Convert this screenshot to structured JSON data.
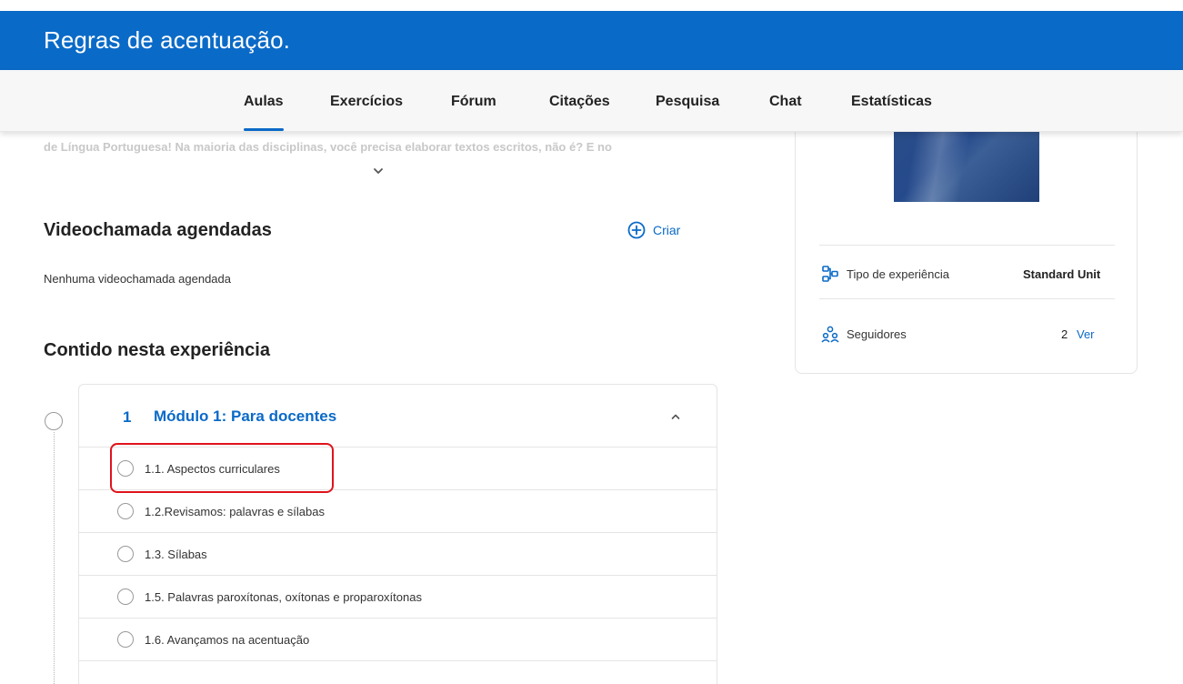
{
  "header": {
    "title": "Regras de acentuação."
  },
  "tabs": [
    {
      "label": "Aulas",
      "active": true
    },
    {
      "label": "Exercícios"
    },
    {
      "label": "Fórum"
    },
    {
      "label": "Citações"
    },
    {
      "label": "Pesquisa"
    },
    {
      "label": "Chat"
    },
    {
      "label": "Estatísticas"
    }
  ],
  "intro": {
    "faded_text": "de Língua Portuguesa! Na maioria das disciplinas, você precisa elaborar textos escritos, não é? E no"
  },
  "videocalls": {
    "title": "Videochamada agendadas",
    "create_label": "Criar",
    "empty_text": "Nenhuma videochamada agendada"
  },
  "content": {
    "title": "Contido nesta experiência",
    "module": {
      "number": "1",
      "title": "Módulo 1: Para docentes",
      "lessons": [
        {
          "label": "1.1. Aspectos curriculares"
        },
        {
          "label": "1.2.Revisamos: palavras e sílabas"
        },
        {
          "label": "1.3. Sílabas"
        },
        {
          "label": "1.5. Palavras paroxítonas, oxítonas e proparoxítonas"
        },
        {
          "label": "1.6. Avançamos na acentuação"
        }
      ]
    }
  },
  "sidebar": {
    "experience_type_label": "Tipo de experiência",
    "experience_type_value": "Standard Unit",
    "followers_label": "Seguidores",
    "followers_count": "2",
    "followers_link": "Ver"
  },
  "colors": {
    "brand": "#0a6ac7",
    "highlight": "#e0131b"
  }
}
